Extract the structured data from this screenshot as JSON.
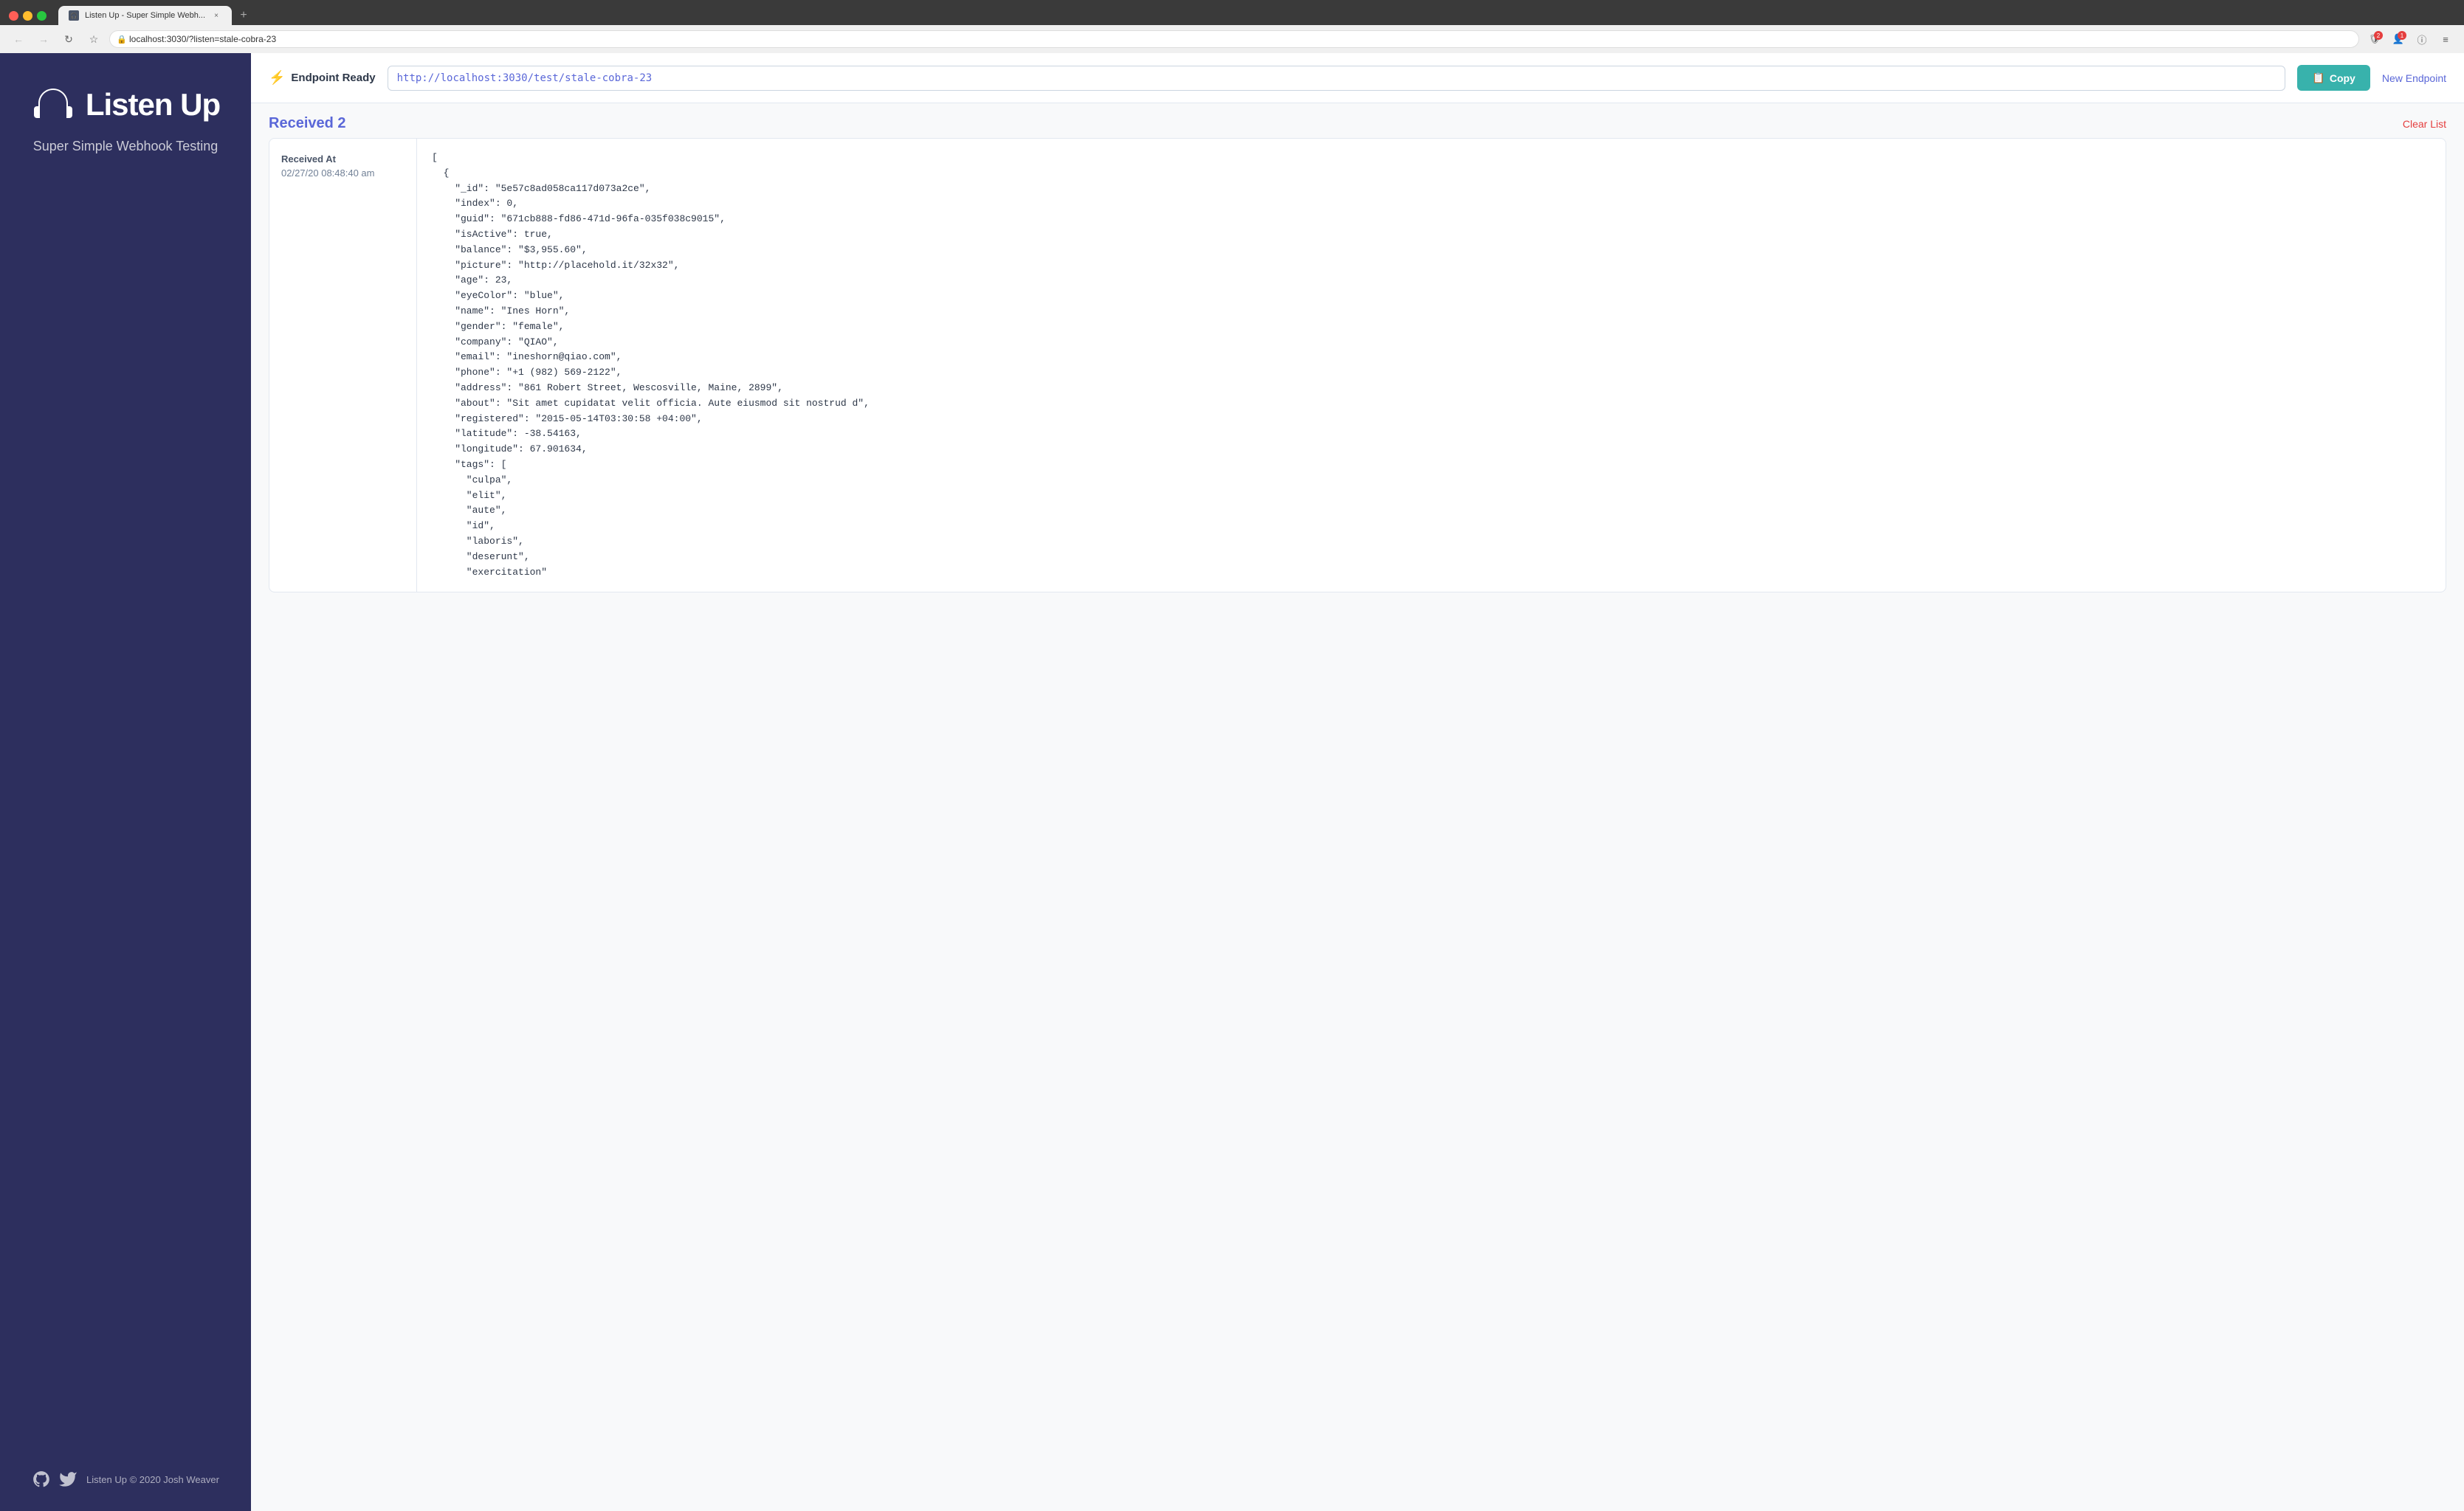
{
  "browser": {
    "tab_title": "Listen Up - Super Simple Webh...",
    "tab_close": "×",
    "new_tab": "+",
    "url": "localhost:3030/?listen=stale-cobra-23",
    "back_icon": "←",
    "forward_icon": "→",
    "refresh_icon": "↻",
    "bookmark_icon": "☆",
    "lock_icon": "🔒",
    "shield_badge": "2",
    "user_badge": "1",
    "info_icon": "ⓘ",
    "menu_icon": "≡"
  },
  "sidebar": {
    "brand_name": "Listen Up",
    "tagline": "Super Simple Webhook Testing",
    "footer_copyright": "Listen Up © 2020 Josh Weaver"
  },
  "endpoint": {
    "status_label": "Endpoint Ready",
    "url": "http://localhost:3030/test/stale-cobra-23",
    "copy_label": "Copy",
    "new_endpoint_label": "New Endpoint"
  },
  "received": {
    "count_label": "Received 2",
    "clear_label": "Clear List"
  },
  "request": {
    "received_at_label": "Received At",
    "received_at_value": "02/27/20 08:48:40 am",
    "body": "[\n  {\n    \"_id\": \"5e57c8ad058ca117d073a2ce\",\n    \"index\": 0,\n    \"guid\": \"671cb888-fd86-471d-96fa-035f038c9015\",\n    \"isActive\": true,\n    \"balance\": \"$3,955.60\",\n    \"picture\": \"http://placehold.it/32x32\",\n    \"age\": 23,\n    \"eyeColor\": \"blue\",\n    \"name\": \"Ines Horn\",\n    \"gender\": \"female\",\n    \"company\": \"QIAO\",\n    \"email\": \"ineshorn@qiao.com\",\n    \"phone\": \"+1 (982) 569-2122\",\n    \"address\": \"861 Robert Street, Wescosville, Maine, 2899\",\n    \"about\": \"Sit amet cupidatat velit officia. Aute eiusmod sit nostrud d\",\n    \"registered\": \"2015-05-14T03:30:58 +04:00\",\n    \"latitude\": -38.54163,\n    \"longitude\": 67.901634,\n    \"tags\": [\n      \"culpa\",\n      \"elit\",\n      \"aute\",\n      \"id\",\n      \"laboris\",\n      \"deserunt\",\n      \"exercitation\""
  }
}
